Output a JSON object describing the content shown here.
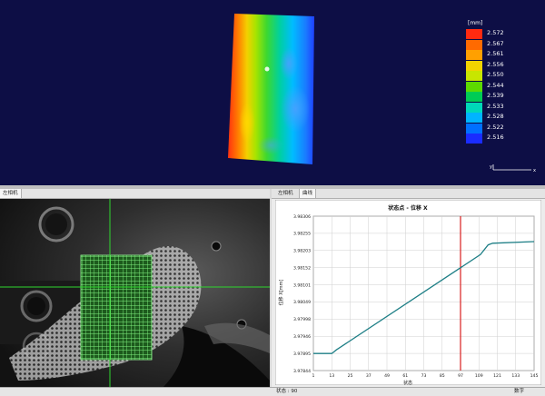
{
  "top_view": {
    "legend": {
      "unit": "[mm]",
      "values": [
        "2.572",
        "2.567",
        "2.561",
        "2.556",
        "2.550",
        "2.544",
        "2.539",
        "2.533",
        "2.528",
        "2.522",
        "2.516"
      ],
      "colors": [
        "#ff2a10",
        "#ff6a00",
        "#ffa000",
        "#f2d400",
        "#c8e600",
        "#5cdb00",
        "#00cc55",
        "#00d8b8",
        "#00b4ff",
        "#0070ff",
        "#1a2cff"
      ]
    },
    "axis_labels": {
      "x": "x",
      "y": "y"
    }
  },
  "camera_panel": {
    "tab_label": "左相机"
  },
  "graph_panel": {
    "tabs": [
      "左相机",
      "曲线"
    ],
    "chart_data": {
      "type": "line",
      "title": "状态点 - 位移 X",
      "ylabel": "位移 X[mm]",
      "xlabel": "状态",
      "x_ticks": [
        1,
        13,
        25,
        37,
        49,
        61,
        73,
        85,
        97,
        109,
        121,
        133,
        145
      ],
      "y_ticks": [
        "3.98306",
        "3.98255",
        "3.98203",
        "3.98152",
        "3.98101",
        "3.98049",
        "3.97998",
        "3.97946",
        "3.97895",
        "3.97844"
      ],
      "xlim": [
        1,
        145
      ],
      "ylim": [
        3.97844,
        3.98306
      ],
      "marker_x": 97,
      "series": [
        {
          "color": "#1e7f86",
          "x": [
            1,
            13,
            16,
            110,
            115,
            118,
            145
          ],
          "y": [
            3.97895,
            3.97895,
            3.97906,
            3.98191,
            3.9822,
            3.98225,
            3.9823
          ]
        }
      ]
    }
  },
  "status_bar": {
    "left": "状态 : 90",
    "right": "数字"
  }
}
